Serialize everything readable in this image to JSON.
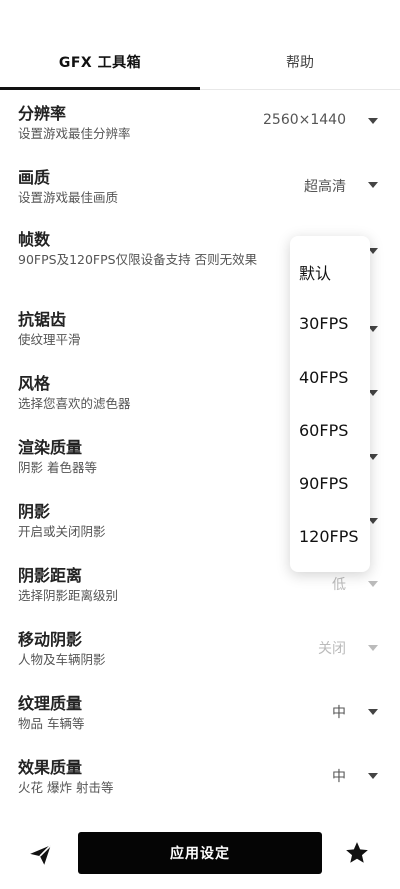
{
  "tabs": {
    "gfx": "GFX 工具箱",
    "help": "帮助"
  },
  "settings": [
    {
      "title": "分辨率",
      "subtitle": "设置游戏最佳分辨率",
      "value": "2560×1440"
    },
    {
      "title": "画质",
      "subtitle": "设置游戏最佳画质",
      "value": "超高清"
    },
    {
      "title": "帧数",
      "subtitle": "90FPS及120FPS仅限设备支持 否则无效果",
      "value": ""
    },
    {
      "title": "抗锯齿",
      "subtitle": "使纹理平滑",
      "value": ""
    },
    {
      "title": "风格",
      "subtitle": "选择您喜欢的滤色器",
      "value": ""
    },
    {
      "title": "渲染质量",
      "subtitle": "阴影 着色器等",
      "value": ""
    },
    {
      "title": "阴影",
      "subtitle": "开启或关闭阴影",
      "value": ""
    },
    {
      "title": "阴影距离",
      "subtitle": "选择阴影距离级别",
      "value": "低"
    },
    {
      "title": "移动阴影",
      "subtitle": "人物及车辆阴影",
      "value": "关闭"
    },
    {
      "title": "纹理质量",
      "subtitle": "物品 车辆等",
      "value": "中"
    },
    {
      "title": "效果质量",
      "subtitle": "火花 爆炸 射击等",
      "value": "中"
    }
  ],
  "fps_dropdown": {
    "options": [
      "默认",
      "30FPS",
      "40FPS",
      "60FPS",
      "90FPS",
      "120FPS"
    ]
  },
  "bottom": {
    "apply_label": "应用设定",
    "send_icon": "send-icon",
    "star_icon": "star-icon"
  }
}
